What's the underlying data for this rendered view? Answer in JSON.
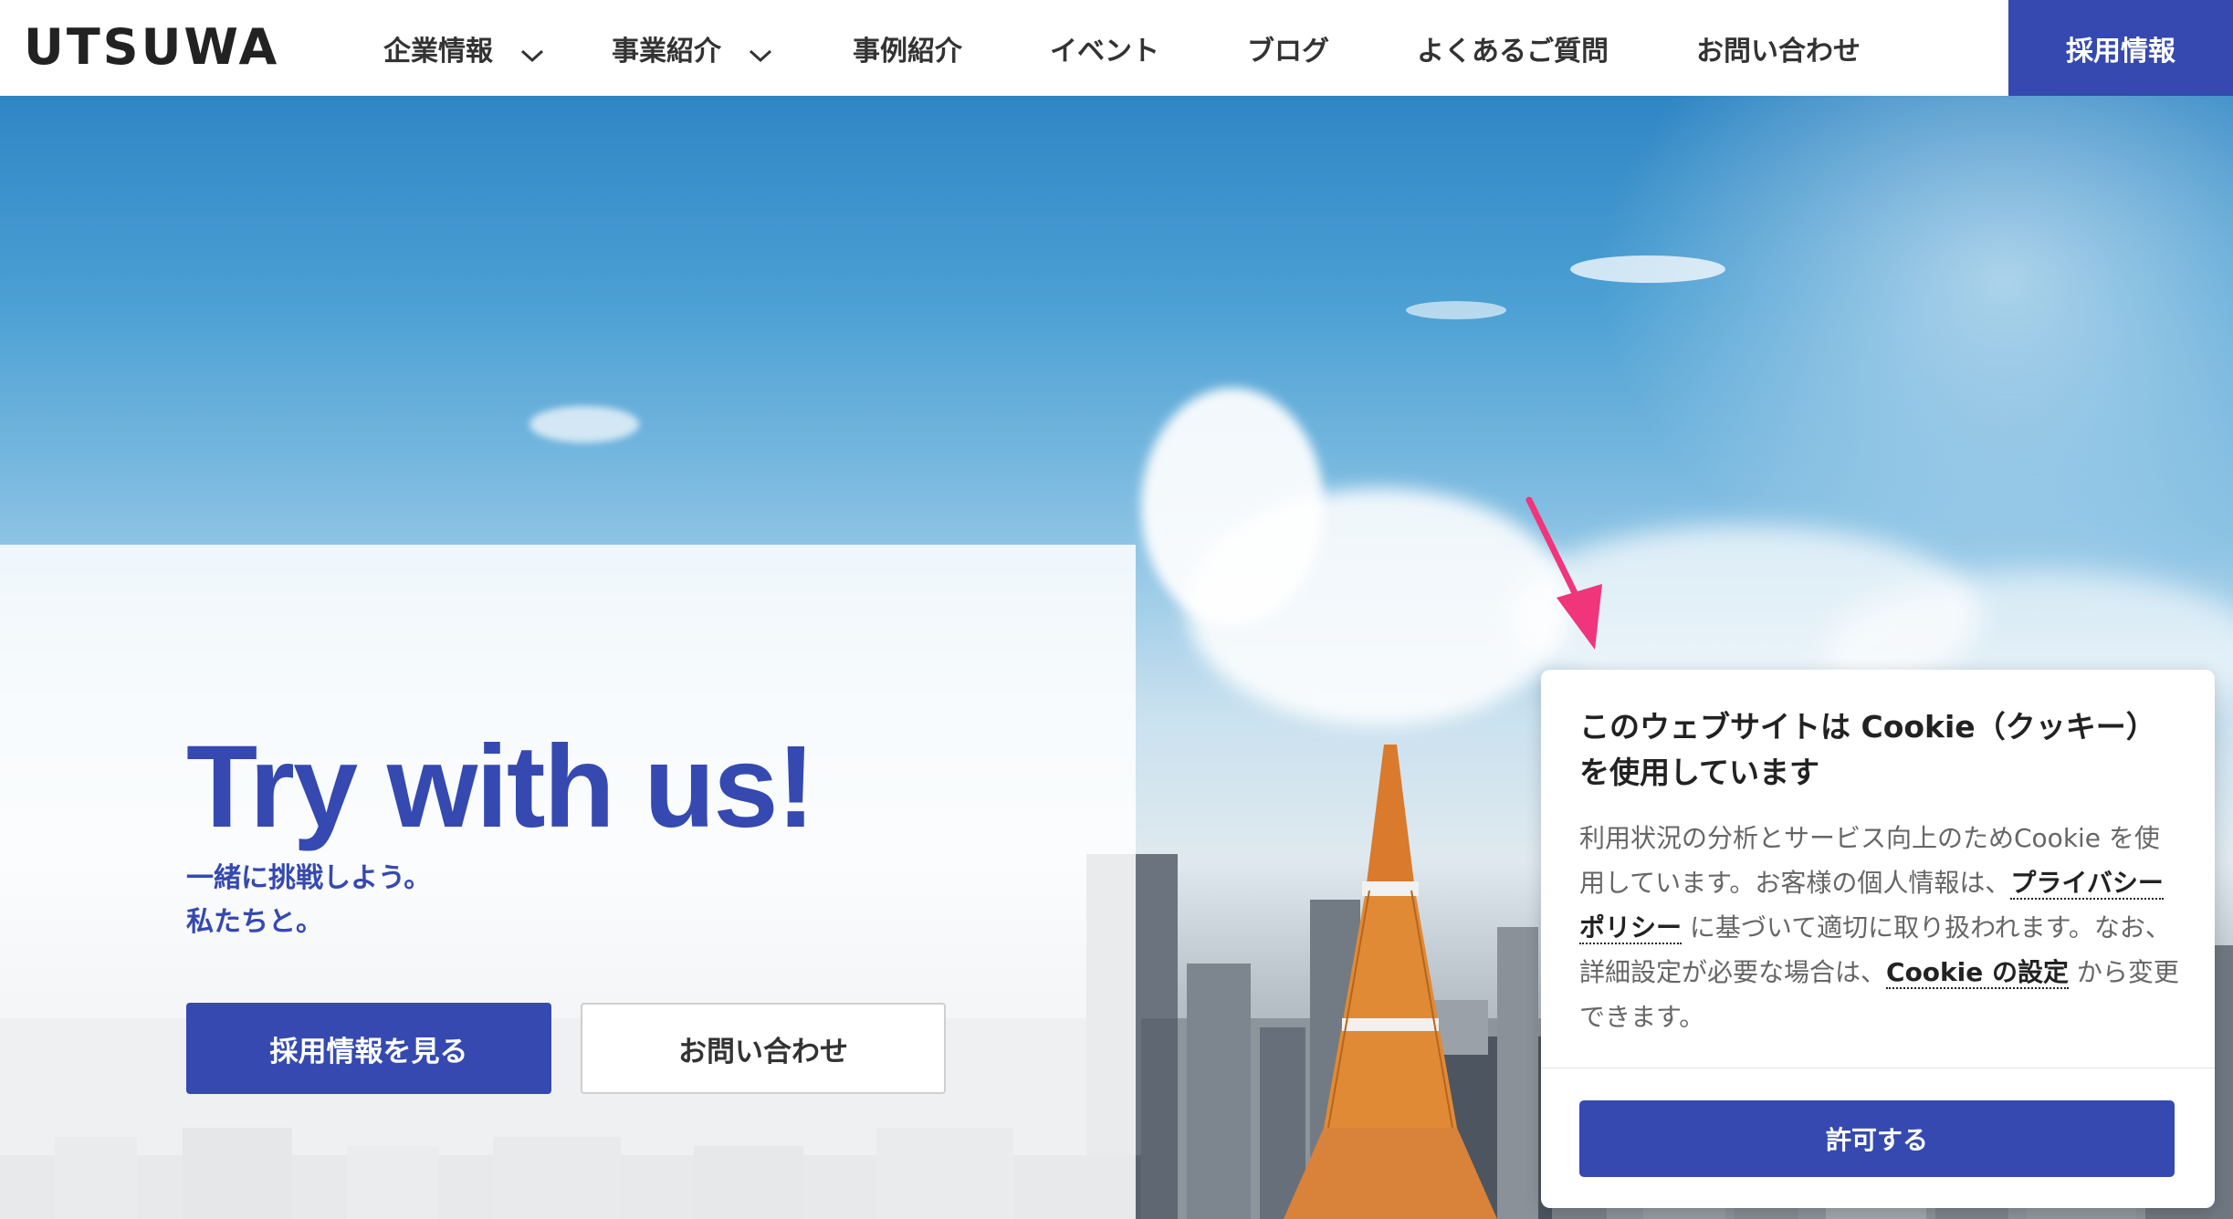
{
  "header": {
    "logo": "UTSUWA",
    "nav": [
      {
        "label": "企業情報",
        "dropdown": true
      },
      {
        "label": "事業紹介",
        "dropdown": true
      },
      {
        "label": "事例紹介",
        "dropdown": false
      },
      {
        "label": "イベント",
        "dropdown": false
      },
      {
        "label": "ブログ",
        "dropdown": false
      },
      {
        "label": "よくあるご質問",
        "dropdown": false
      },
      {
        "label": "お問い合わせ",
        "dropdown": false
      }
    ],
    "recruit_button": "採用情報"
  },
  "hero": {
    "headline": "Try with us!",
    "subline_1": "一緒に挑戦しよう。",
    "subline_2": "私たちと。",
    "primary_button": "採用情報を見る",
    "secondary_button": "お問い合わせ"
  },
  "cookie": {
    "title": "このウェブサイトは Cookie（クッキー）を使用しています",
    "body_1": "利用状況の分析とサービス向上のためCookie を使用しています。お客様の個人情報は、",
    "privacy_link": "プライバシーポリシー",
    "body_2": " に基づいて適切に取り扱われます。なお、詳細設定が必要な場合は、",
    "settings_link": "Cookie の設定",
    "body_3": " から変更できます。",
    "allow_button": "許可する"
  },
  "colors": {
    "brand_blue": "#3549b0",
    "arrow_pink": "#f0357a"
  }
}
